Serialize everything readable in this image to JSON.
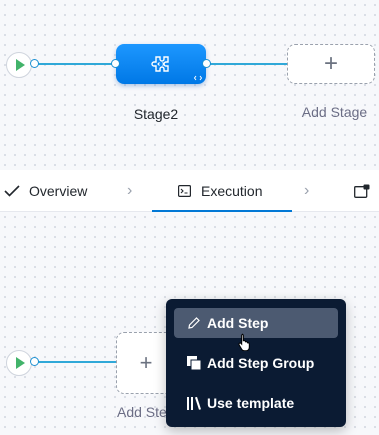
{
  "pipeline": {
    "stage": {
      "name": "Stage2",
      "icon": "custom-stage-icon"
    },
    "add_stage_label": "Add Stage",
    "colors": {
      "stage": "#0a84ec",
      "connector": "#30a8d8",
      "start": "#42b36a"
    }
  },
  "tabs": {
    "items": [
      {
        "label": "Overview",
        "icon": "check-icon"
      },
      {
        "label": "Execution",
        "icon": "execution-icon",
        "active": true
      }
    ]
  },
  "execution": {
    "add_step_label": "Add Step"
  },
  "menu": {
    "items": [
      {
        "label": "Add Step",
        "icon": "pencil-icon",
        "highlighted": true
      },
      {
        "label": "Add Step Group",
        "icon": "step-group-icon"
      },
      {
        "label": "Use template",
        "icon": "template-library-icon"
      }
    ]
  }
}
